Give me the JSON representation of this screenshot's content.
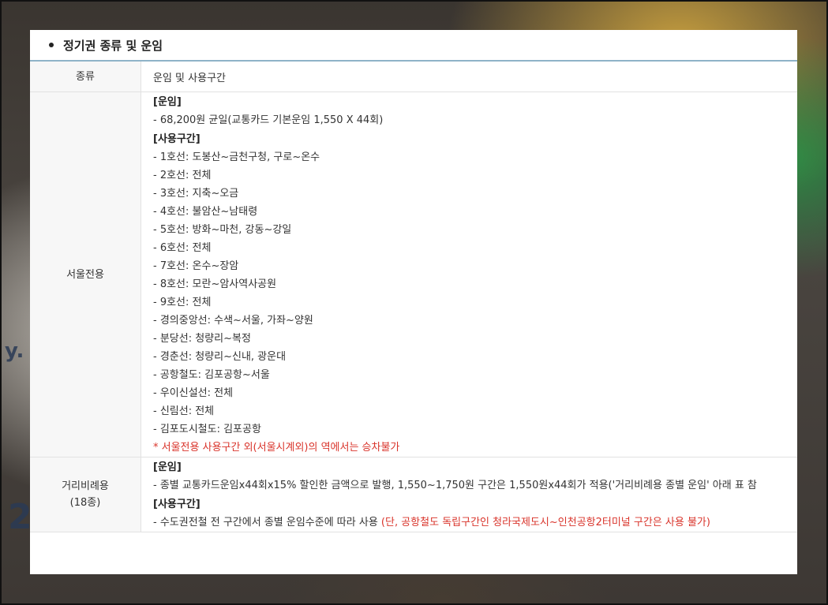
{
  "section": {
    "title": "정기권 종류 및 운임"
  },
  "table": {
    "header": {
      "type_col": "종류",
      "fare_col": "운임 및 사용구간"
    },
    "seoul": {
      "label": "서울전용",
      "fare_heading": "[운임]",
      "fare_line": "- 68,200원 균일(교통카드 기본운임 1,550 X 44회)",
      "section_heading": "[사용구간]",
      "lines": [
        "- 1호선: 도봉산~금천구청, 구로~온수",
        "- 2호선: 전체",
        "- 3호선: 지축~오금",
        "- 4호선: 불암산~남태령",
        "- 5호선: 방화~마천, 강동~강일",
        "- 6호선: 전체",
        "- 7호선: 온수~장암",
        "- 8호선: 모란~암사역사공원",
        "- 9호선: 전체",
        "- 경의중앙선: 수색~서울, 가좌~양원",
        "- 분당선: 청량리~복정",
        "- 경춘선: 청량리~신내, 광운대",
        "- 공항철도: 김포공항~서울",
        "- 우이신설선: 전체",
        "- 신림선: 전체",
        "- 김포도시철도: 김포공항"
      ],
      "note": "* 서울전용 사용구간 외(서울시계외)의 역에서는 승차불가"
    },
    "distance": {
      "label_line1": "거리비례용",
      "label_line2": "(18종)",
      "fare_heading": "[운임]",
      "fare_line": "- 종별 교통카드운임x44회x15% 할인한 금액으로 발행, 1,550~1,750원 구간은 1,550원x44회가 적용('거리비례용 종별 운임' 아래 표 참",
      "section_heading": "[사용구간]",
      "section_line": "- 수도권전철 전 구간에서 종별 운임수준에 따라 사용 ",
      "section_note": "(단, 공항철도 독립구간인 청라국제도시~인천공항2터미널 구간은 사용 불가)"
    }
  },
  "background": {
    "fragment_a": "y.",
    "fragment_b": "2"
  },
  "colors": {
    "accent_line": "#8fb3c8",
    "note_red": "#d9342b"
  }
}
